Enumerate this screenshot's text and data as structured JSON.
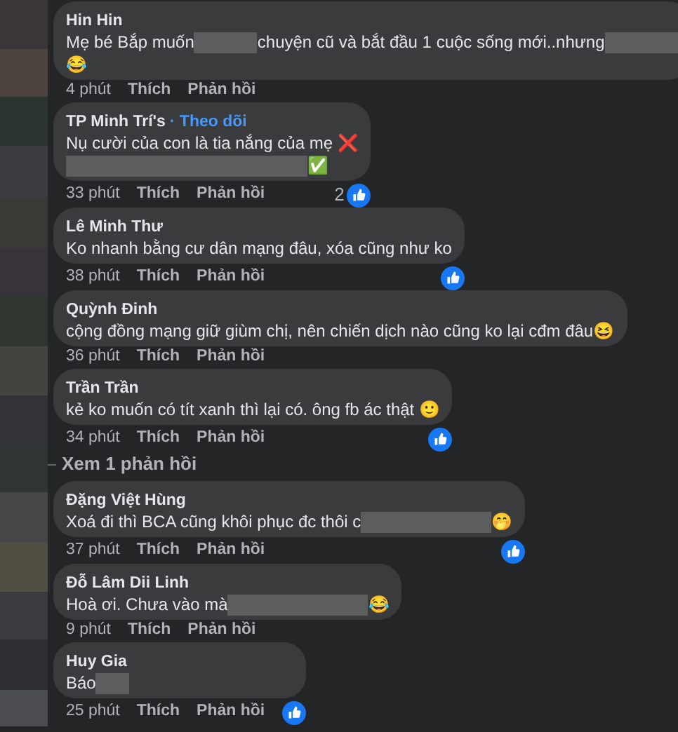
{
  "comments": [
    {
      "author": "Hin Hin",
      "lines": [
        [
          {
            "kind": "text",
            "text": "Mẹ bé Bắp muốn "
          },
          {
            "kind": "redacted"
          },
          {
            "kind": "text",
            "text": " chuyện cũ và bắt đầu 1 cuộc sống mới..nhưng"
          },
          {
            "kind": "redacted"
          }
        ],
        [
          {
            "kind": "text",
            "text": "😂"
          }
        ]
      ],
      "time": "4 phút",
      "like_label": "Thích",
      "reply_label": "Phản hồi",
      "reacted": false
    },
    {
      "author": "TP Minh Trí's",
      "follow_label": "· Theo dõi",
      "lines": [
        [
          {
            "kind": "text",
            "text": "Nụ cười của con là tia nắng của mẹ ❌"
          }
        ],
        [
          {
            "kind": "redacted"
          },
          {
            "kind": "text",
            "text": "✅"
          }
        ]
      ],
      "time": "33 phút",
      "like_label": "Thích",
      "reply_label": "Phản hồi",
      "reacted": true,
      "reaction_count": "2"
    },
    {
      "author": "Lê Minh Thư",
      "lines": [
        [
          {
            "kind": "text",
            "text": "Ko nhanh bằng cư dân mạng đâu, xóa cũng như ko"
          }
        ]
      ],
      "time": "38 phút",
      "like_label": "Thích",
      "reply_label": "Phản hồi",
      "reacted": true
    },
    {
      "author": "Quỳnh Đinh",
      "lines": [
        [
          {
            "kind": "text",
            "text": "cộng đồng mạng giữ giùm chị, nên chiến dịch nào cũng ko lại cđm đâu😆"
          }
        ]
      ],
      "time": "36 phút",
      "like_label": "Thích",
      "reply_label": "Phản hồi",
      "reacted": false
    },
    {
      "author": "Trần Trần",
      "lines": [
        [
          {
            "kind": "text",
            "text": "kẻ ko muốn có tít xanh thì lại có. ông fb ác thật 🙂"
          }
        ]
      ],
      "time": "34 phút",
      "like_label": "Thích",
      "reply_label": "Phản hồi",
      "reacted": true,
      "more_replies": "Xem 1 phản hồi"
    },
    {
      "author": "Đặng Việt Hùng",
      "lines": [
        [
          {
            "kind": "text",
            "text": "Xoá đi thì BCA cũng khôi phục đc thôi c"
          },
          {
            "kind": "redacted"
          },
          {
            "kind": "text",
            "text": "🤭"
          }
        ]
      ],
      "time": "37 phút",
      "like_label": "Thích",
      "reply_label": "Phản hồi",
      "reacted": true
    },
    {
      "author": "Đỗ Lâm Dii Linh",
      "lines": [
        [
          {
            "kind": "text",
            "text": "Hoà ơi. Chưa vào mà "
          },
          {
            "kind": "redacted"
          },
          {
            "kind": "text",
            "text": "😂"
          }
        ]
      ],
      "time": "9 phút",
      "like_label": "Thích",
      "reply_label": "Phản hồi",
      "reacted": false
    },
    {
      "author": "Huy Gia",
      "lines": [
        [
          {
            "kind": "text",
            "text": "Báo "
          },
          {
            "kind": "redacted"
          }
        ]
      ],
      "time": "25 phút",
      "like_label": "Thích",
      "reply_label": "Phản hồi",
      "reacted": true
    }
  ]
}
